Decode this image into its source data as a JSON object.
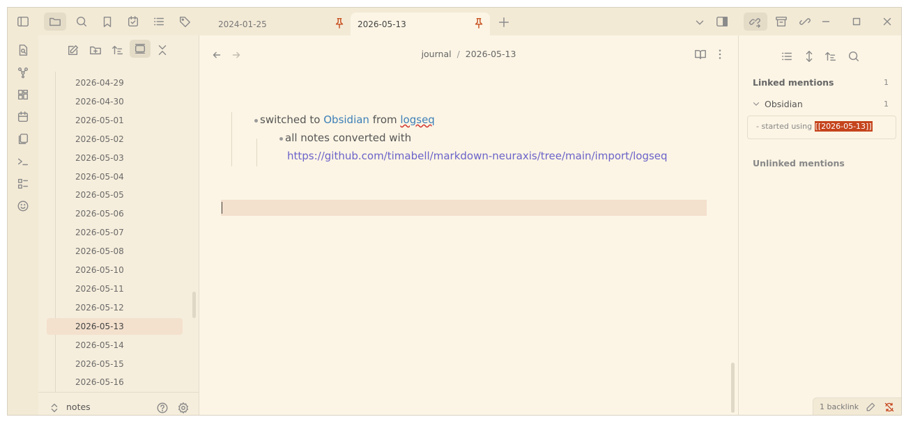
{
  "tabs": [
    {
      "label": "2024-01-25",
      "pinned": true
    },
    {
      "label": "2026-05-13",
      "pinned": true,
      "active": true
    }
  ],
  "breadcrumb": {
    "folder": "journal",
    "separator": "/",
    "file": "2026-05-13"
  },
  "files": [
    "2026-04-29",
    "2026-04-30",
    "2026-05-01",
    "2026-05-02",
    "2026-05-03",
    "2026-05-04",
    "2026-05-05",
    "2026-05-06",
    "2026-05-07",
    "2026-05-08",
    "2026-05-10",
    "2026-05-11",
    "2026-05-12",
    "2026-05-13",
    "2026-05-14",
    "2026-05-15",
    "2026-05-16"
  ],
  "selected_file": "2026-05-13",
  "vault": {
    "name": "notes"
  },
  "note": {
    "line1_pre": "switched to ",
    "line1_link": "Obsidian",
    "line1_mid": " from ",
    "line1_link2": "logseq",
    "line2": "all notes converted with",
    "line3_url": "https://github.com/timabell/markdown-neuraxis/tree/main/import/logseq"
  },
  "backlinks": {
    "linked_title": "Linked mentions",
    "linked_count": "1",
    "group_title": "Obsidian",
    "group_count": "1",
    "snippet_pre": "- started using ",
    "snippet_highlight": "[[2026-05-13]]",
    "unlinked_title": "Unlinked mentions"
  },
  "status": {
    "backlinks": "1 backlink"
  },
  "colors": {
    "background": "#fcf5e5",
    "accent": "#c74f1f",
    "highlight": "#c5441c",
    "link": "#3d7fb8",
    "url": "#6b62c9",
    "selection": "#f3e0cd"
  }
}
